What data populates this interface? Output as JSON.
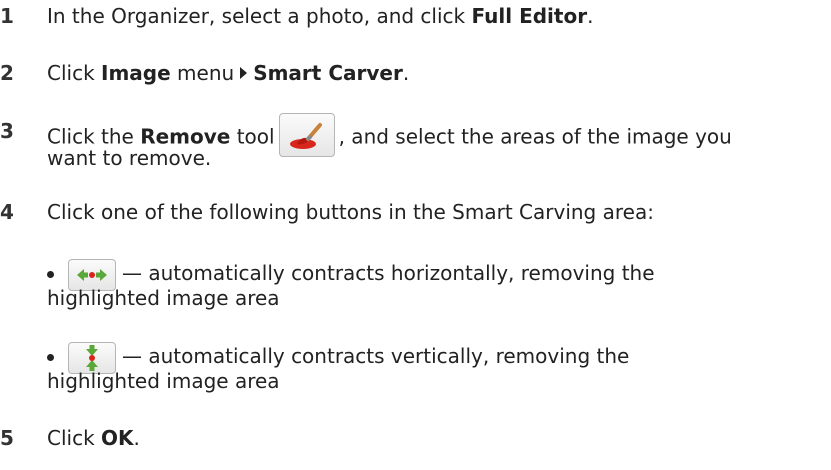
{
  "steps": [
    {
      "num": "1",
      "pre": "In the Organizer, select a photo, and click ",
      "bold": "Full Editor",
      "post": "."
    },
    {
      "num": "2",
      "pre": "Click ",
      "bold1": "Image",
      "mid": " menu",
      "bold2": "Smart Carver",
      "post": "."
    },
    {
      "num": "3",
      "pre": "Click the ",
      "bold": "Remove",
      "mid": " tool",
      "post1": ", and select the areas of the image you",
      "post2": "want to remove.",
      "icon": "remove-brush-icon"
    },
    {
      "num": "4",
      "text": "Click one of the following buttons in the Smart Carving area:"
    },
    {
      "num": "5",
      "pre": "Click ",
      "bold": "OK",
      "post": "."
    }
  ],
  "bullets": [
    {
      "line1": "— automatically contracts horizontally, removing the",
      "line2": "highlighted image area",
      "icon": "contract-horizontal-icon"
    },
    {
      "line1": "— automatically contracts vertically, removing the",
      "line2": "highlighted image area",
      "icon": "contract-vertical-icon"
    }
  ]
}
